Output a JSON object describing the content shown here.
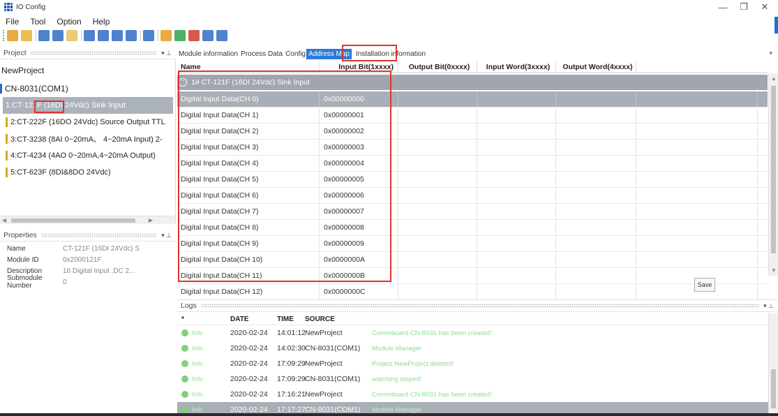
{
  "window": {
    "title": "IO Config",
    "controls": {
      "minimize": "—",
      "restore": "❐",
      "close": "✕"
    }
  },
  "menu": [
    "File",
    "Tool",
    "Option",
    "Help"
  ],
  "toolbar": {
    "buttons": [
      {
        "icon": "home-icon",
        "color": "#e69b1e"
      },
      {
        "icon": "open-folder-icon",
        "color": "#e8b430"
      },
      {
        "icon": "save-icon",
        "color": "#2f6cc7"
      },
      {
        "icon": "save-as-icon",
        "color": "#2f6cc7"
      },
      {
        "icon": "settings-icon",
        "color": "#e8c060"
      },
      {
        "icon": "search-icon",
        "color": "#2f6cc7"
      },
      {
        "icon": "upload-icon",
        "color": "#2f6cc7"
      },
      {
        "icon": "download-icon",
        "color": "#2f6cc7"
      },
      {
        "icon": "info-icon",
        "color": "#2f6cc7"
      },
      {
        "icon": "grid-icon",
        "color": "#2f6cc7"
      },
      {
        "icon": "power-icon",
        "color": "#e69b1e"
      },
      {
        "icon": "network-icon",
        "color": "#2fa34a"
      },
      {
        "icon": "delete-icon",
        "color": "#d23b2e"
      },
      {
        "icon": "monitor-icon",
        "color": "#2f6cc7"
      },
      {
        "icon": "copy-icon",
        "color": "#2f6cc7"
      }
    ]
  },
  "project": {
    "header": "Project",
    "root": "NewProject",
    "coupler": "CN-8031(COM1)",
    "modules": [
      "1:CT-121F (16DI 24Vdc) Sink Input",
      "2:CT-222F (16DO 24Vdc) Source Output TTL",
      "3:CT-3238 (8AI 0~20mA、 4~20mA Input) 2-",
      "4:CT-4234 (4AO 0~20mA,4~20mA Output)",
      "5:CT-623F (8DI&8DO 24Vdc)"
    ]
  },
  "properties": {
    "header": "Properties",
    "rows": [
      {
        "key": "Name",
        "value": "CT-121F (16DI 24Vdc) S"
      },
      {
        "key": "Module ID",
        "value": "0x2000121F"
      },
      {
        "key": "Description",
        "value": "16 Digital Input ,DC 2..."
      },
      {
        "key": "Submodule Number",
        "value": "0"
      }
    ]
  },
  "tabs": [
    "Module information",
    "Process Data",
    "Config Params",
    "Address Map",
    "Installation information"
  ],
  "active_tab": "Address Map",
  "address_map": {
    "columns": [
      "Name",
      "Input Bit(1xxxx)",
      "Output Bit(0xxxx)",
      "Input Word(3xxxx)",
      "Output Word(4xxxx)"
    ],
    "group_label": "1# CT-121F (16DI 24Vdc) Sink Input",
    "rows": [
      {
        "name": "Digital Input Data(CH 0)",
        "input_bit": "0x00000000"
      },
      {
        "name": "Digital Input Data(CH 1)",
        "input_bit": "0x00000001"
      },
      {
        "name": "Digital Input Data(CH 2)",
        "input_bit": "0x00000002"
      },
      {
        "name": "Digital Input Data(CH 3)",
        "input_bit": "0x00000003"
      },
      {
        "name": "Digital Input Data(CH 4)",
        "input_bit": "0x00000004"
      },
      {
        "name": "Digital Input Data(CH 5)",
        "input_bit": "0x00000005"
      },
      {
        "name": "Digital Input Data(CH 6)",
        "input_bit": "0x00000006"
      },
      {
        "name": "Digital Input Data(CH 7)",
        "input_bit": "0x00000007"
      },
      {
        "name": "Digital Input Data(CH 8)",
        "input_bit": "0x00000008"
      },
      {
        "name": "Digital Input Data(CH 9)",
        "input_bit": "0x00000009"
      },
      {
        "name": "Digital Input Data(CH 10)",
        "input_bit": "0x0000000A"
      },
      {
        "name": "Digital Input Data(CH 11)",
        "input_bit": "0x0000000B"
      },
      {
        "name": "Digital Input Data(CH 12)",
        "input_bit": "0x0000000C"
      }
    ],
    "save_label": "Save"
  },
  "logs": {
    "header": "Logs",
    "columns": [
      "*",
      "DATE",
      "TIME",
      "SOURCE"
    ],
    "rows": [
      {
        "level": "Info",
        "date": "2020-02-24",
        "time": "14:01:12",
        "source": "NewProject",
        "message": "Commboard CN-8031 has been created!"
      },
      {
        "level": "Info",
        "date": "2020-02-24",
        "time": "14:02:30",
        "source": "CN-8031(COM1)",
        "message": "Module Manager"
      },
      {
        "level": "Info",
        "date": "2020-02-24",
        "time": "17:09:29",
        "source": "NewProject",
        "message": "Project NewProject deleted!"
      },
      {
        "level": "Info",
        "date": "2020-02-24",
        "time": "17:09:29",
        "source": "CN-8031(COM1)",
        "message": "watching stoped!"
      },
      {
        "level": "Info",
        "date": "2020-02-24",
        "time": "17:16:21",
        "source": "NewProject",
        "message": "Commboard CN-8031 has been created!"
      },
      {
        "level": "Info",
        "date": "2020-02-24",
        "time": "17:17:27",
        "source": "CN-8031(COM1)",
        "message": "Module Manager"
      }
    ]
  }
}
